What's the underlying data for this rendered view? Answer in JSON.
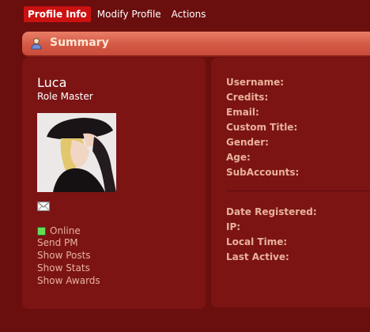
{
  "tabs": [
    {
      "label": "Profile Info",
      "active": true
    },
    {
      "label": "Modify Profile",
      "active": false
    },
    {
      "label": "Actions",
      "active": false
    }
  ],
  "summary": {
    "title": "Summary",
    "icon": "user-icon"
  },
  "profile": {
    "name": "Luca",
    "role": "Role Master",
    "status": "Online",
    "links": [
      "Send PM",
      "Show Posts",
      "Show Stats",
      "Show Awards"
    ]
  },
  "details": {
    "group1": [
      "Username:",
      "Credits:",
      "Email:",
      "Custom Title:",
      "Gender:",
      "Age:",
      "SubAccounts:"
    ],
    "group2": [
      "Date Registered:",
      "IP:",
      "Local Time:",
      "Last Active:"
    ]
  },
  "colors": {
    "background": "#6b0e0e",
    "panel": "#7c1414",
    "accent": "#cc1111",
    "link": "#e8b29b",
    "online": "#66dd55"
  }
}
